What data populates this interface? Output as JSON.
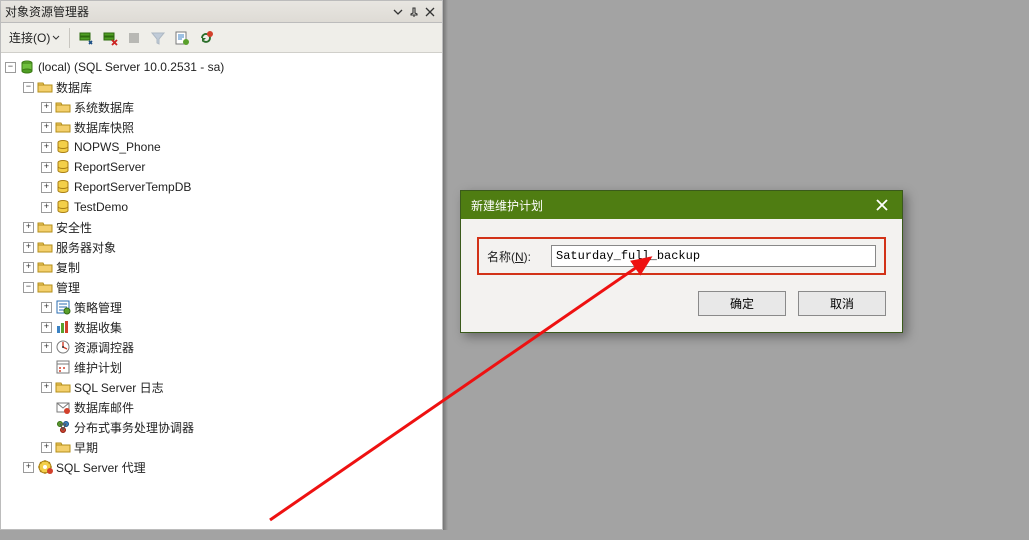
{
  "panel": {
    "title": "对象资源管理器",
    "pin_tooltip": "固定",
    "close_tooltip": "关闭",
    "dropdown_icon": "chevron-down"
  },
  "toolbar": {
    "connect_label": "连接(O)",
    "buttons": [
      {
        "name": "connect-server-icon",
        "disabled": false
      },
      {
        "name": "disconnect-server-icon",
        "disabled": false
      },
      {
        "name": "stop-icon",
        "disabled": true
      },
      {
        "name": "filter-icon",
        "disabled": true
      },
      {
        "name": "script-icon",
        "disabled": false
      },
      {
        "name": "refresh-icon",
        "disabled": false
      }
    ]
  },
  "tree": {
    "server_label": "(local) (SQL Server 10.0.2531 - sa)",
    "databases_label": "数据库",
    "databases_children": [
      {
        "icon": "folder",
        "label": "系统数据库",
        "expander": "+"
      },
      {
        "icon": "folder",
        "label": "数据库快照",
        "expander": "+"
      },
      {
        "icon": "database",
        "label": "NOPWS_Phone",
        "expander": "+"
      },
      {
        "icon": "database",
        "label": "ReportServer",
        "expander": "+"
      },
      {
        "icon": "database",
        "label": "ReportServerTempDB",
        "expander": "+"
      },
      {
        "icon": "database",
        "label": "TestDemo",
        "expander": "+"
      }
    ],
    "toplevel_after_db": [
      {
        "icon": "folder",
        "label": "安全性",
        "expander": "+"
      },
      {
        "icon": "folder",
        "label": "服务器对象",
        "expander": "+"
      },
      {
        "icon": "folder",
        "label": "复制",
        "expander": "+"
      }
    ],
    "management_label": "管理",
    "management_children": [
      {
        "icon": "policy",
        "label": "策略管理",
        "expander": "+"
      },
      {
        "icon": "collect",
        "label": "数据收集",
        "expander": "+"
      },
      {
        "icon": "governor",
        "label": "资源调控器",
        "expander": "+"
      },
      {
        "icon": "plan",
        "label": "维护计划",
        "expander": ""
      },
      {
        "icon": "folder",
        "label": "SQL Server 日志",
        "expander": "+"
      },
      {
        "icon": "mail",
        "label": "数据库邮件",
        "expander": ""
      },
      {
        "icon": "dtc",
        "label": "分布式事务处理协调器",
        "expander": ""
      },
      {
        "icon": "folder",
        "label": "早期",
        "expander": "+"
      }
    ],
    "agent_label": "SQL Server 代理"
  },
  "dialog": {
    "title": "新建维护计划",
    "name_label_prefix": "名称(",
    "name_label_key": "N",
    "name_label_suffix": "):",
    "name_value": "Saturday_full_backup",
    "ok": "确定",
    "cancel": "取消"
  }
}
